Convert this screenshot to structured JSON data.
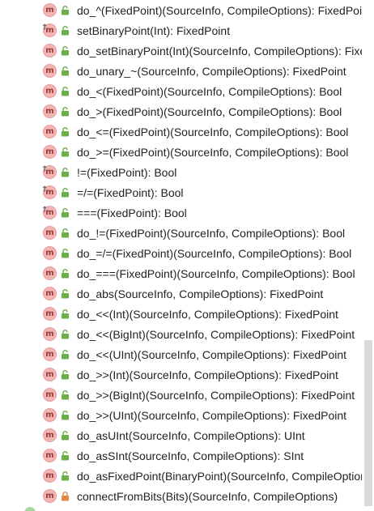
{
  "colors": {
    "method_icon_bg": "#f3b5b5",
    "method_icon_letter": "#9c3b3b",
    "lock_open": "#6aaf4a",
    "lock_closed": "#e08a4a",
    "text": "#222222",
    "scrollbar_thumb": "#d9d9d9"
  },
  "members": [
    {
      "icon": "method-icon",
      "overlay": false,
      "lock": "open",
      "signature": "do_^(FixedPoint)(SourceInfo, CompileOptions): FixedPoint"
    },
    {
      "icon": "method-icon",
      "overlay": true,
      "lock": "open",
      "signature": "setBinaryPoint(Int): FixedPoint"
    },
    {
      "icon": "method-icon",
      "overlay": false,
      "lock": "open",
      "signature": "do_setBinaryPoint(Int)(SourceInfo, CompileOptions): FixedPoint"
    },
    {
      "icon": "method-icon",
      "overlay": false,
      "lock": "open",
      "signature": "do_unary_~(SourceInfo, CompileOptions): FixedPoint"
    },
    {
      "icon": "method-icon",
      "overlay": false,
      "lock": "open",
      "signature": "do_<(FixedPoint)(SourceInfo, CompileOptions): Bool"
    },
    {
      "icon": "method-icon",
      "overlay": false,
      "lock": "open",
      "signature": "do_>(FixedPoint)(SourceInfo, CompileOptions): Bool"
    },
    {
      "icon": "method-icon",
      "overlay": false,
      "lock": "open",
      "signature": "do_<=(FixedPoint)(SourceInfo, CompileOptions): Bool"
    },
    {
      "icon": "method-icon",
      "overlay": false,
      "lock": "open",
      "signature": "do_>=(FixedPoint)(SourceInfo, CompileOptions): Bool"
    },
    {
      "icon": "method-icon",
      "overlay": true,
      "lock": "open",
      "signature": "!=(FixedPoint): Bool"
    },
    {
      "icon": "method-icon",
      "overlay": true,
      "lock": "open",
      "signature": "=/=(FixedPoint): Bool"
    },
    {
      "icon": "method-icon",
      "overlay": true,
      "lock": "open",
      "signature": "===(FixedPoint): Bool"
    },
    {
      "icon": "method-icon",
      "overlay": false,
      "lock": "open",
      "signature": "do_!=(FixedPoint)(SourceInfo, CompileOptions): Bool"
    },
    {
      "icon": "method-icon",
      "overlay": false,
      "lock": "open",
      "signature": "do_=/=(FixedPoint)(SourceInfo, CompileOptions): Bool"
    },
    {
      "icon": "method-icon",
      "overlay": false,
      "lock": "open",
      "signature": "do_===(FixedPoint)(SourceInfo, CompileOptions): Bool"
    },
    {
      "icon": "method-icon",
      "overlay": false,
      "lock": "open",
      "signature": "do_abs(SourceInfo, CompileOptions): FixedPoint"
    },
    {
      "icon": "method-icon",
      "overlay": false,
      "lock": "open",
      "signature": "do_<<(Int)(SourceInfo, CompileOptions): FixedPoint"
    },
    {
      "icon": "method-icon",
      "overlay": false,
      "lock": "open",
      "signature": "do_<<(BigInt)(SourceInfo, CompileOptions): FixedPoint"
    },
    {
      "icon": "method-icon",
      "overlay": false,
      "lock": "open",
      "signature": "do_<<(UInt)(SourceInfo, CompileOptions): FixedPoint"
    },
    {
      "icon": "method-icon",
      "overlay": false,
      "lock": "open",
      "signature": "do_>>(Int)(SourceInfo, CompileOptions): FixedPoint"
    },
    {
      "icon": "method-icon",
      "overlay": false,
      "lock": "open",
      "signature": "do_>>(BigInt)(SourceInfo, CompileOptions): FixedPoint"
    },
    {
      "icon": "method-icon",
      "overlay": false,
      "lock": "open",
      "signature": "do_>>(UInt)(SourceInfo, CompileOptions): FixedPoint"
    },
    {
      "icon": "method-icon",
      "overlay": false,
      "lock": "open",
      "signature": "do_asUInt(SourceInfo, CompileOptions): UInt"
    },
    {
      "icon": "method-icon",
      "overlay": false,
      "lock": "open",
      "signature": "do_asSInt(SourceInfo, CompileOptions): SInt"
    },
    {
      "icon": "method-icon",
      "overlay": false,
      "lock": "open",
      "signature": "do_asFixedPoint(BinaryPoint)(SourceInfo, CompileOptions): FixedPoint"
    },
    {
      "icon": "method-icon",
      "overlay": false,
      "lock": "closed",
      "signature": "connectFromBits(Bits)(SourceInfo, CompileOptions)"
    }
  ]
}
